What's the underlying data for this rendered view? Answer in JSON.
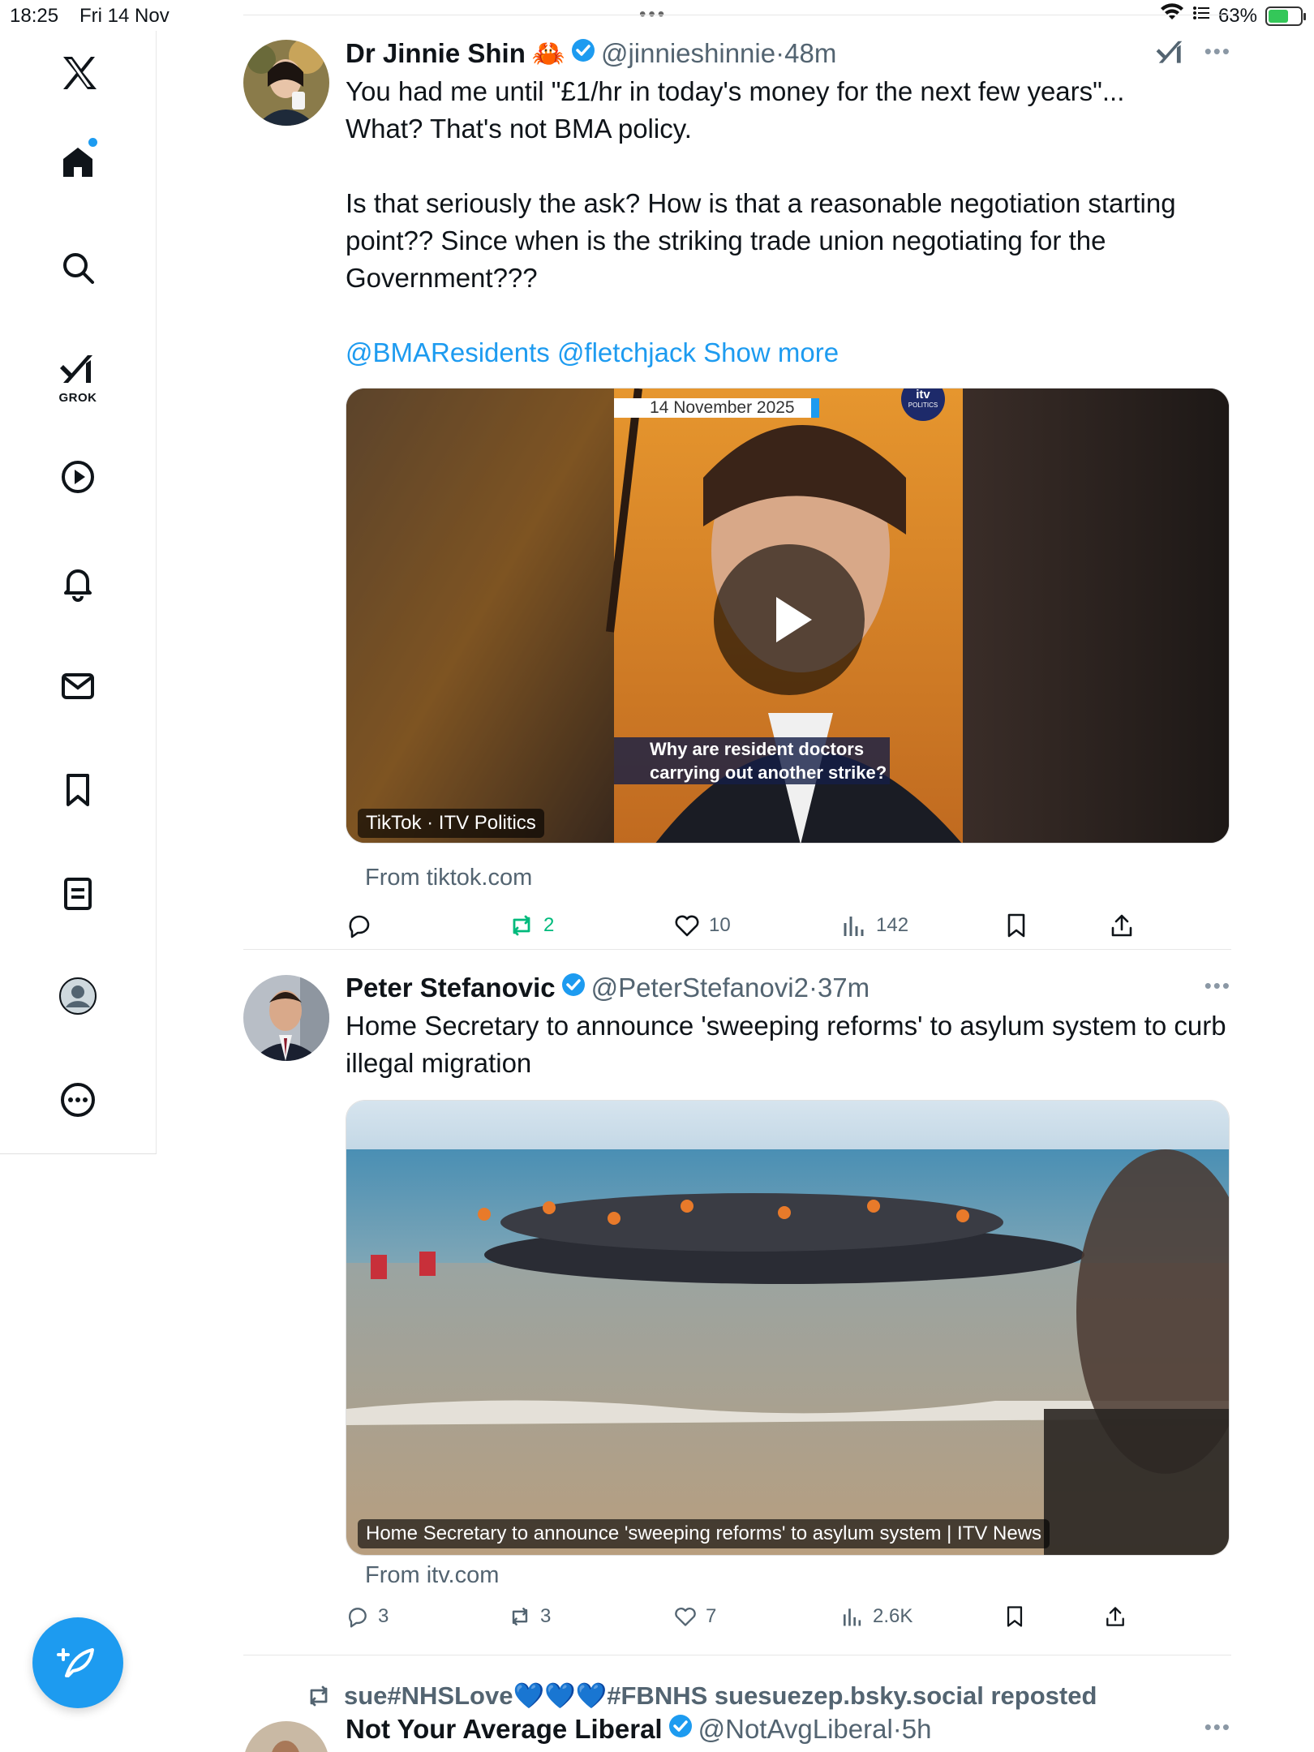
{
  "status_bar": {
    "time": "18:25",
    "date": "Fri 14 Nov",
    "dots": "•••",
    "battery_pct": "63%",
    "battery_level": 0.63
  },
  "sidebar": {
    "grok_label": "GROK",
    "items": [
      "x-logo",
      "home",
      "search",
      "grok",
      "video",
      "notifications",
      "messages",
      "bookmarks",
      "lists",
      "profile",
      "more"
    ]
  },
  "feed": {
    "tweets": [
      {
        "name": "Dr Jinnie Shin",
        "emoji": "🦀",
        "handle": "@jinnieshinnie",
        "sep": "·",
        "time": "48m",
        "more": "•••",
        "text_p1a": "You had me until \"£1/hr in today's money for the next few years\"...",
        "text_p1b": "What? That's not BMA policy.",
        "text_p2": "Is that seriously the ask? How is that a reasonable negotiation starting point?? Since when is the striking trade union negotiating for the Government???",
        "mention1": "@BMAResidents",
        "mention2": "@fletchjack",
        "show_more": "Show more",
        "media_date": "14 November 2025",
        "media_logo": "itv",
        "media_logo_sub": "POLITICS",
        "media_subtitle_1": "Why are resident doctors",
        "media_subtitle_2": "carrying out another strike?",
        "media_caption": "TikTok · ITV Politics",
        "from": "From tiktok.com",
        "reposts": "2",
        "likes": "10",
        "views": "142"
      },
      {
        "name": "Peter Stefanovic",
        "handle": "@PeterStefanovi2",
        "sep": "·",
        "time": "37m",
        "more": "•••",
        "text": "Home Secretary to announce 'sweeping reforms' to asylum system to curb illegal migration",
        "media_caption": "Home Secretary to announce 'sweeping reforms' to asylum system | ITV News",
        "from": "From itv.com",
        "replies": "3",
        "reposts": "3",
        "likes": "7",
        "views": "2.6K"
      },
      {
        "repost_by": "sue#NHSLove💙💙💙#FBNHS suesuezep.bsky.social reposted",
        "name": "Not Your Average Liberal",
        "handle": "@NotAvgLiberal",
        "sep": "·",
        "time": "5h",
        "more": "•••"
      }
    ]
  },
  "colors": {
    "accent": "#1d9bf0",
    "repost_green": "#00ba7c",
    "muted": "#536471",
    "text": "#0f1419"
  }
}
